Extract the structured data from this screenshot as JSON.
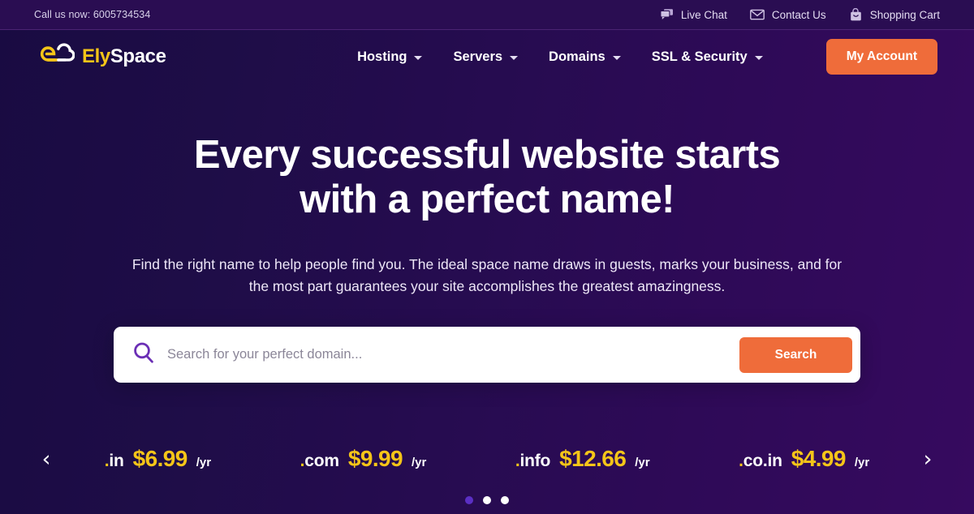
{
  "topbar": {
    "phone_label": "Call us now: 6005734534",
    "links": [
      {
        "label": "Live Chat",
        "icon": "chat-icon"
      },
      {
        "label": "Contact Us",
        "icon": "envelope-icon"
      },
      {
        "label": "Shopping Cart",
        "icon": "shopping-bag-icon"
      }
    ]
  },
  "nav": {
    "logo": {
      "primary": "Ely",
      "secondary": "Space",
      "icon": "cloud-e-logo-icon"
    },
    "menu": [
      {
        "label": "Hosting"
      },
      {
        "label": "Servers"
      },
      {
        "label": "Domains"
      },
      {
        "label": "SSL & Security"
      }
    ],
    "account_button": "My Account"
  },
  "hero": {
    "heading": "Every successful website starts with a perfect name!",
    "subheading": "Find the right name to help people find you. The ideal space name draws in guests, marks your business, and for the most part guarantees your site accomplishes the greatest amazingness."
  },
  "search": {
    "placeholder": "Search for your perfect domain...",
    "value": "",
    "button_label": "Search",
    "icon": "search-icon"
  },
  "carousel": {
    "prev_label": "‹",
    "next_label": "›",
    "items": [
      {
        "dot": ".",
        "tld": "in",
        "price": "$6.99",
        "per": "/yr"
      },
      {
        "dot": ".",
        "tld": "com",
        "price": "$9.99",
        "per": "/yr"
      },
      {
        "dot": ".",
        "tld": "info",
        "price": "$12.66",
        "per": "/yr"
      },
      {
        "dot": ".",
        "tld": "co.in",
        "price": "$4.99",
        "per": "/yr"
      }
    ],
    "pagination": [
      {
        "active": true
      },
      {
        "active": false
      },
      {
        "active": false
      }
    ]
  },
  "colors": {
    "accent_orange": "#ef6c3a",
    "accent_yellow": "#f5c518",
    "topbar_bg": "#2a0d52",
    "bg_start": "#190b42",
    "bg_end": "#360a5f",
    "active_dot": "#5b2fc4"
  }
}
